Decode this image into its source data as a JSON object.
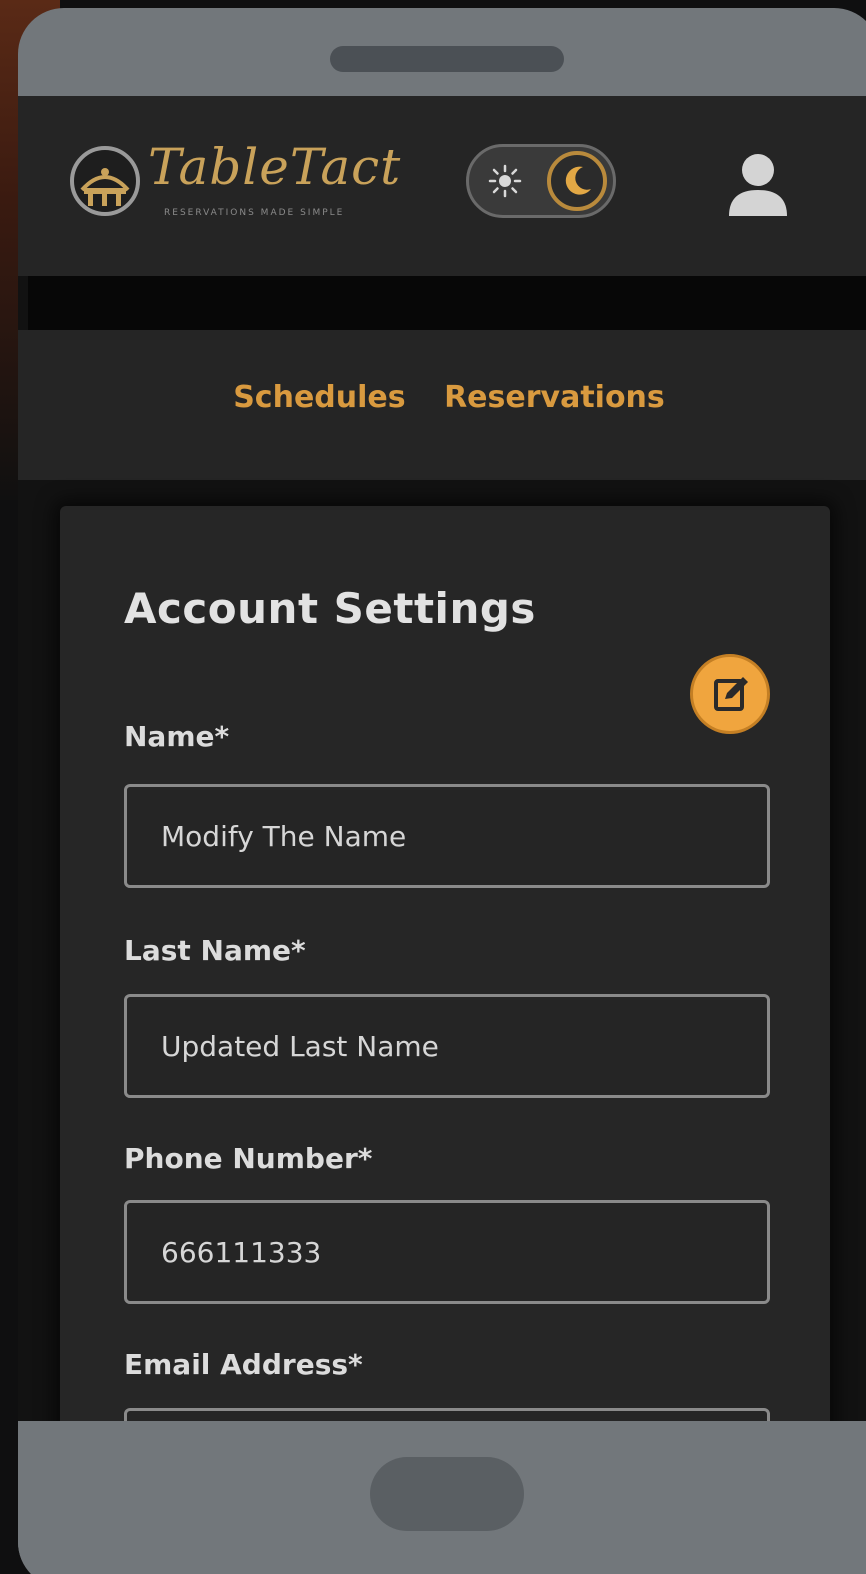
{
  "app": {
    "logo_text": "TableTact",
    "logo_tagline": "RESERVATIONS MADE SIMPLE"
  },
  "header": {
    "theme_mode": "dark",
    "profile_icon": "user-icon"
  },
  "nav": {
    "items": [
      {
        "label": "Schedules"
      },
      {
        "label": "Reservations"
      }
    ]
  },
  "account": {
    "title": "Account Settings",
    "edit_icon": "edit-icon",
    "fields": [
      {
        "label": "Name*",
        "value": "Modify The Name"
      },
      {
        "label": "Last Name*",
        "value": "Updated Last Name"
      },
      {
        "label": "Phone Number*",
        "value": "666111333"
      },
      {
        "label": "Email Address*",
        "value": ""
      }
    ]
  },
  "colors": {
    "accent": "#d99a3f",
    "edit_button": "#f0a53e",
    "background": "#252525"
  }
}
